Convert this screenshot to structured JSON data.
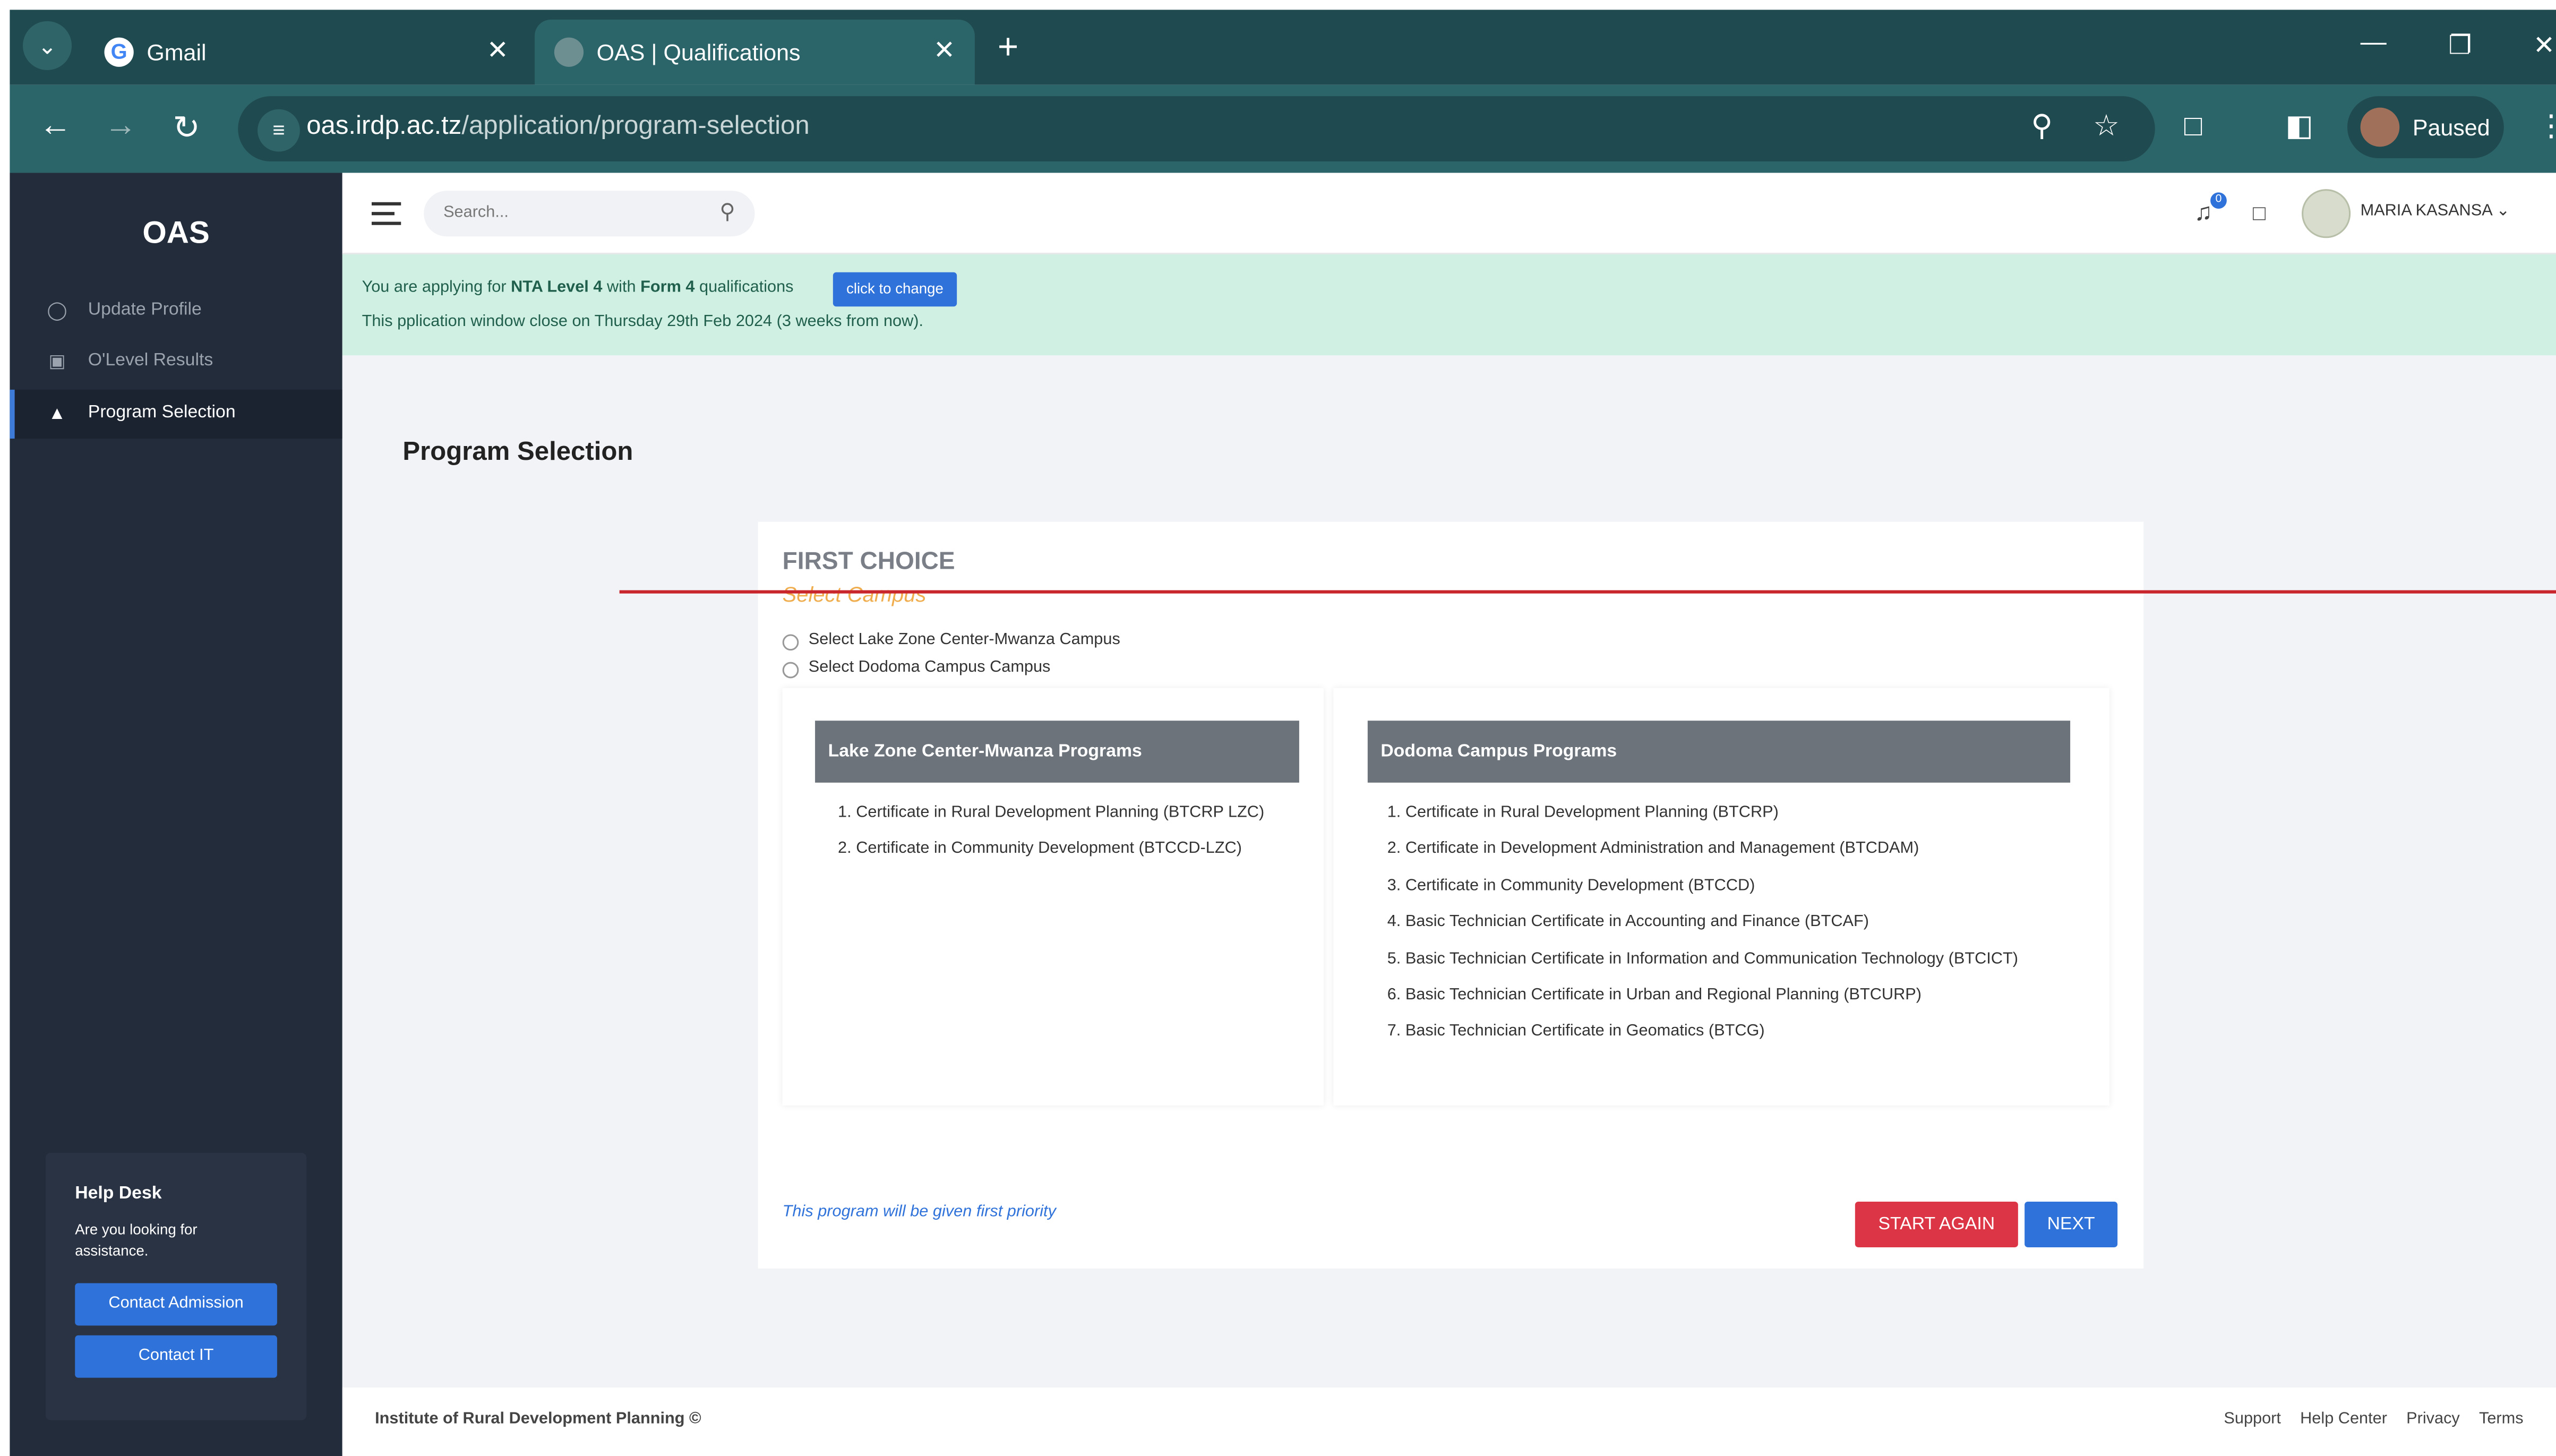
{
  "browser": {
    "tabs": [
      {
        "title": "Gmail",
        "active": false
      },
      {
        "title": "OAS | Qualifications",
        "active": true
      }
    ],
    "url_domain": "oas.irdp.ac.tz",
    "url_path": "/application/program-selection",
    "profile_status": "Paused",
    "icons": {
      "tab_scroll": "chevron-down-icon",
      "new_tab": "plus-icon",
      "minimize": "minimize-icon",
      "restore": "restore-icon",
      "close": "close-icon",
      "back": "back-arrow-icon",
      "forward": "forward-arrow-icon",
      "reload": "reload-icon",
      "site_info": "site-info-icon",
      "zoom": "zoom-icon",
      "bookmark": "star-icon",
      "extensions": "puzzle-icon",
      "sidepanel": "sidepanel-icon",
      "menu": "kebab-menu-icon"
    }
  },
  "sidebar": {
    "brand": "OAS",
    "items": [
      {
        "label": "Update Profile",
        "icon": "user-icon",
        "active": false
      },
      {
        "label": "O'Level Results",
        "icon": "book-icon",
        "active": false
      },
      {
        "label": "Program Selection",
        "icon": "graduation-cap-icon",
        "active": true
      }
    ],
    "helpdesk": {
      "title": "Help Desk",
      "text": "Are you looking for assistance.",
      "buttons": [
        "Contact Admission",
        "Contact IT"
      ]
    }
  },
  "header": {
    "search_placeholder": "Search...",
    "notification_count": "0",
    "user_name": "MARIA KASANSA"
  },
  "notice": {
    "prefix": "You are applying for ",
    "level": "NTA Level 4",
    "middle": " with ",
    "qualification": "Form 4",
    "suffix": " qualifications",
    "change_button": "click to change",
    "window_text": "This pplication window close on Thursday 29th Feb 2024 (3 weeks from now)."
  },
  "main": {
    "page_title": "Program Selection",
    "choice_title": "FIRST CHOICE",
    "choice_subtitle": "Select Campus",
    "campus_options": [
      "Select Lake Zone Center-Mwanza Campus",
      "Select Dodoma Campus Campus"
    ],
    "panels": [
      {
        "title": "Lake Zone Center-Mwanza Programs",
        "programs": [
          "1. Certificate in Rural Development Planning (BTCRP LZC)",
          "2. Certificate in Community Development (BTCCD-LZC)"
        ]
      },
      {
        "title": "Dodoma Campus Programs",
        "programs": [
          "1. Certificate in Rural Development Planning (BTCRP)",
          "2. Certificate in Development Administration and Management (BTCDAM)",
          "3. Certificate in Community Development (BTCCD)",
          "4. Basic Technician Certificate in Accounting and Finance (BTCAF)",
          "5. Basic Technician Certificate in Information and Communication Technology (BTCICT)",
          "6. Basic Technician Certificate in Urban and Regional Planning (BTCURP)",
          "7. Basic Technician Certificate in Geomatics (BTCG)"
        ]
      }
    ],
    "priority_note": "This program will be given first priority",
    "start_again": "START AGAIN",
    "next": "NEXT"
  },
  "footer": {
    "copyright": "Institute of Rural Development Planning ©",
    "links": [
      "Support",
      "Help Center",
      "Privacy",
      "Terms"
    ]
  },
  "colors": {
    "sidebar_bg": "#232c3b",
    "notice_bg": "#d1f0e4",
    "primary": "#2f72d9",
    "danger": "#dc3545",
    "accent_orange": "#f0ad4e"
  }
}
